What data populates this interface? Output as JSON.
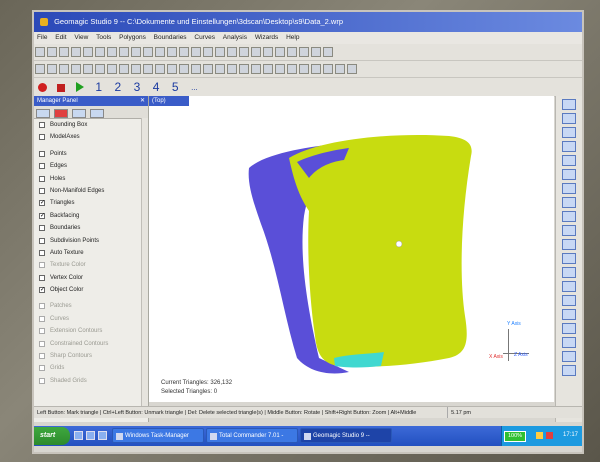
{
  "window": {
    "title": "Geomagic Studio 9 -- C:\\Dokumente und Einstellungen\\3dscan\\Desktop\\s9\\Data_2.wrp"
  },
  "menu": [
    "File",
    "Edit",
    "View",
    "Tools",
    "Polygons",
    "Boundaries",
    "Curves",
    "Analysis",
    "Wizards",
    "Help"
  ],
  "macro_toolbar": {
    "numbers": [
      "1",
      "2",
      "3",
      "4",
      "5"
    ],
    "extra": "..."
  },
  "panel": {
    "title": "Manager Panel",
    "close": "✕",
    "items": [
      {
        "label": "Bounding Box",
        "checked": false,
        "enabled": true
      },
      {
        "label": "ModelAxes",
        "checked": false,
        "enabled": true
      },
      {
        "label": "Points",
        "checked": false,
        "enabled": true
      },
      {
        "label": "Edges",
        "checked": false,
        "enabled": true
      },
      {
        "label": "Holes",
        "checked": false,
        "enabled": true
      },
      {
        "label": "Non-Manifold Edges",
        "checked": false,
        "enabled": true
      },
      {
        "label": "Triangles",
        "checked": true,
        "enabled": true
      },
      {
        "label": "Backfacing",
        "checked": true,
        "enabled": true
      },
      {
        "label": "Boundaries",
        "checked": false,
        "enabled": true
      },
      {
        "label": "Subdivision Points",
        "checked": false,
        "enabled": true
      },
      {
        "label": "Auto Texture",
        "checked": false,
        "enabled": true
      },
      {
        "label": "Texture Color",
        "checked": false,
        "enabled": false
      },
      {
        "label": "Vertex Color",
        "checked": false,
        "enabled": true
      },
      {
        "label": "Object Color",
        "checked": true,
        "enabled": true
      },
      {
        "label": "Patches",
        "checked": false,
        "enabled": false
      },
      {
        "label": "Curves",
        "checked": false,
        "enabled": false
      },
      {
        "label": "Extension Contours",
        "checked": false,
        "enabled": false
      },
      {
        "label": "Constrained Contours",
        "checked": false,
        "enabled": false
      },
      {
        "label": "Sharp Contours",
        "checked": false,
        "enabled": false
      },
      {
        "label": "Grids",
        "checked": false,
        "enabled": false
      },
      {
        "label": "Shaded Grids",
        "checked": false,
        "enabled": false
      }
    ]
  },
  "viewport": {
    "view_label": "(Top)",
    "current_triangles": "Current Triangles: 326,132",
    "selected_triangles": "Selected Triangles: 0",
    "axes": {
      "x": "Y Axis",
      "y": "Z Axis",
      "z": "X Axis"
    },
    "colors": {
      "model_front": "#c8dc10",
      "model_back": "#5a4fd8",
      "accent_cyan": "#40d8d0"
    }
  },
  "status": {
    "text": "Left Button: Mark triangle | Ctrl+Left Button: Unmark triangle | Del: Delete selected triangle(s) | Middle Button: Rotate | Shift+Right Button: Zoom | Alt+Middle",
    "time": "5.17 pm"
  },
  "taskbar": {
    "start": "start",
    "tasks": [
      {
        "label": "Windows Task-Manager",
        "active": false
      },
      {
        "label": "Total Commander 7.01 -",
        "active": false
      },
      {
        "label": "Geomagic Studio 9 --",
        "active": true
      }
    ],
    "zoom": "100%",
    "clock": "17:17"
  }
}
